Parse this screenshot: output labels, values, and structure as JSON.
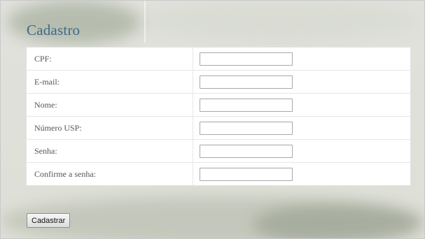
{
  "form": {
    "title": "Cadastro",
    "fields": [
      {
        "label": "CPF:",
        "value": ""
      },
      {
        "label": "E-mail:",
        "value": ""
      },
      {
        "label": "Nome:",
        "value": ""
      },
      {
        "label": "Número USP:",
        "value": ""
      },
      {
        "label": "Senha:",
        "value": ""
      },
      {
        "label": "Confirme a senha:",
        "value": ""
      }
    ],
    "submit_label": "Cadastrar"
  },
  "colors": {
    "title": "#3e6a8a",
    "panel_background": "#e8e8e4",
    "table_background": "#ffffff"
  }
}
